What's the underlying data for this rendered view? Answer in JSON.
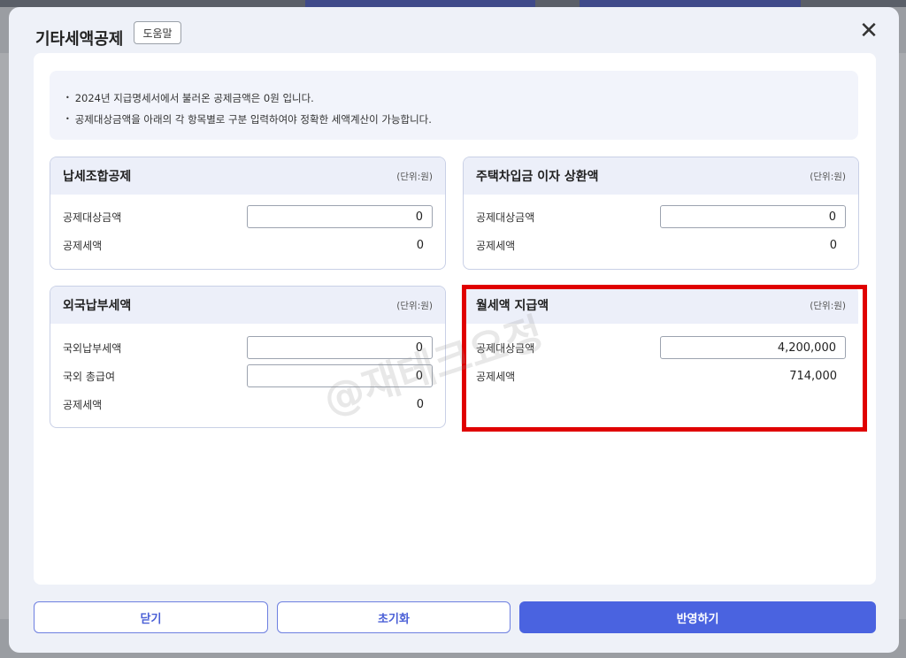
{
  "modal": {
    "title": "기타세액공제",
    "help_label": "도움말",
    "close_glyph": "✕"
  },
  "notice": {
    "lines": [
      "2024년 지급명세서에서 불러온 공제금액은 0원 입니다.",
      "공제대상금액을 아래의 각 항목별로 구분 입력하여야 정확한 세액계산이 가능합니다."
    ]
  },
  "cards": {
    "tax_union": {
      "title": "납세조합공제",
      "unit": "(단위:원)",
      "deduction_target_label": "공제대상금액",
      "deduction_target_value": "0",
      "deduction_tax_label": "공제세액",
      "deduction_tax_value": "0"
    },
    "housing_loan": {
      "title": "주택차입금 이자 상환액",
      "unit": "(단위:원)",
      "deduction_target_label": "공제대상금액",
      "deduction_target_value": "0",
      "deduction_tax_label": "공제세액",
      "deduction_tax_value": "0"
    },
    "foreign_tax": {
      "title": "외국납부세액",
      "unit": "(단위:원)",
      "foreign_paid_label": "국외납부세액",
      "foreign_paid_value": "0",
      "foreign_salary_label": "국외 총급여",
      "foreign_salary_value": "0",
      "deduction_tax_label": "공제세액",
      "deduction_tax_value": "0"
    },
    "monthly_rent": {
      "title": "월세액 지급액",
      "unit": "(단위:원)",
      "deduction_target_label": "공제대상금액",
      "deduction_target_value": "4,200,000",
      "deduction_tax_label": "공제세액",
      "deduction_tax_value": "714,000"
    }
  },
  "watermark": "@재테크요정",
  "footer": {
    "close_label": "닫기",
    "reset_label": "초기화",
    "apply_label": "반영하기"
  },
  "colors": {
    "primary": "#4a63e0",
    "highlight": "#e00000"
  }
}
